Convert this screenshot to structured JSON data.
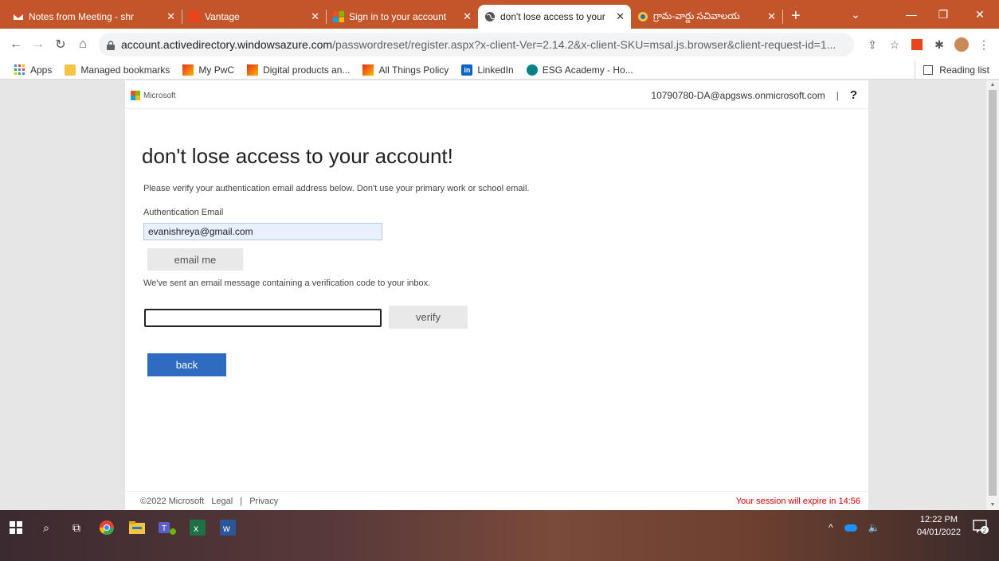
{
  "browser": {
    "tabs": [
      {
        "title": "Notes from Meeting - shr",
        "favicon": "gmail-icon",
        "active": false
      },
      {
        "title": "Vantage",
        "favicon": "vantage-icon",
        "active": false
      },
      {
        "title": "Sign in to your account",
        "favicon": "microsoft-icon",
        "active": false
      },
      {
        "title": "don't lose access to your",
        "favicon": "globe-icon",
        "active": true
      },
      {
        "title": "గ్రామ-వార్డు సచివాలయ",
        "favicon": "emblem-icon",
        "active": false
      }
    ],
    "new_tab": "+",
    "url_host": "account.activedirectory.windowsazure.com",
    "url_path": "/passwordreset/register.aspx?x-client-Ver=2.14.2&x-client-SKU=msal.js.browser&client-request-id=1...",
    "bookmarks": [
      {
        "label": "Apps",
        "icon": "apps-grid-icon"
      },
      {
        "label": "Managed bookmarks",
        "icon": "folder-icon"
      },
      {
        "label": "My PwC",
        "icon": "pwc-icon"
      },
      {
        "label": "Digital products an...",
        "icon": "pwc-icon"
      },
      {
        "label": "All Things Policy",
        "icon": "pwc-icon"
      },
      {
        "label": "LinkedIn",
        "icon": "linkedin-icon"
      },
      {
        "label": "ESG Academy - Ho...",
        "icon": "sharepoint-icon"
      }
    ],
    "reading_list": "Reading list"
  },
  "page": {
    "brand": "Microsoft",
    "account": "10790780-DA@apgsws.onmicrosoft.com",
    "separator": "|",
    "help": "?",
    "heading": "don't lose access to your account!",
    "instruction": "Please verify your authentication email address below. Don't use your primary work or school email.",
    "field_label": "Authentication Email",
    "email_value": "evanishreya@gmail.com",
    "email_me_button": "email me",
    "sent_message": "We've sent an email message containing a verification code to your inbox.",
    "code_value": "",
    "verify_button": "verify",
    "back_button": "back",
    "footer_copyright": "©2022 Microsoft",
    "footer_legal": "Legal",
    "footer_separator": "|",
    "footer_privacy": "Privacy",
    "session_expiry": "Your session will expire in 14:56"
  },
  "taskbar": {
    "time": "12:22 PM",
    "date": "04/01/2022",
    "notification_count": "2"
  },
  "colors": {
    "tabstrip": "#c3552a",
    "primary_button": "#2f6cc1",
    "session_warning": "#cc0000",
    "autofill_bg": "#e8f0fe"
  }
}
